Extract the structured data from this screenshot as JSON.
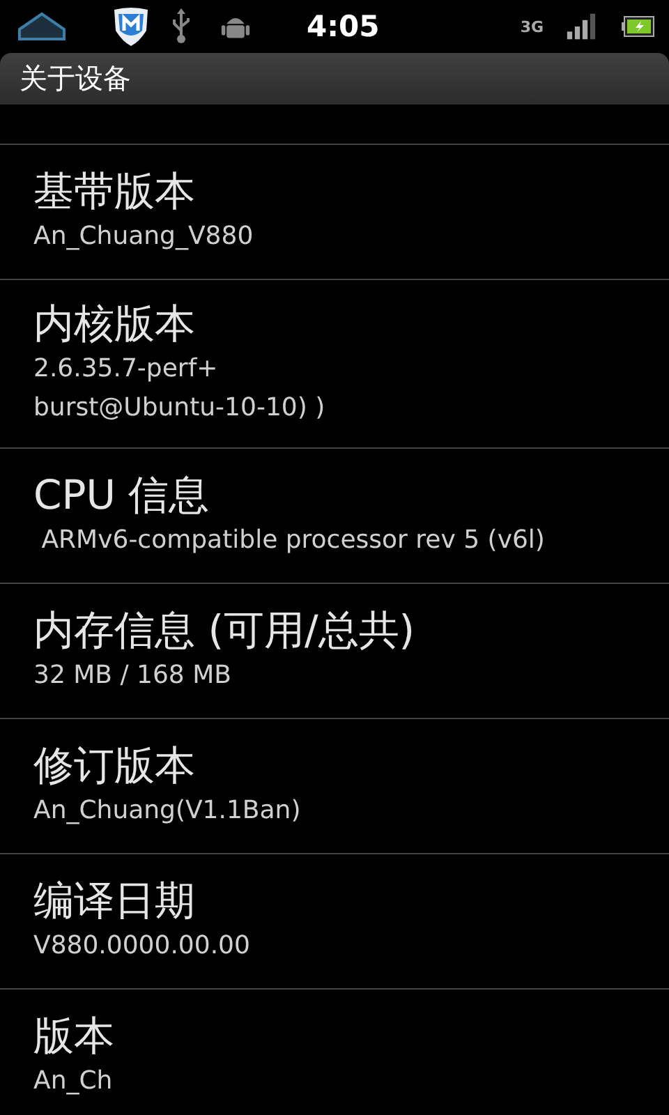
{
  "status_bar": {
    "time": "4:05",
    "network": "3G"
  },
  "title_bar": {
    "title": "关于设备"
  },
  "items": [
    {
      "title": "基带版本",
      "value": "An_Chuang_V880"
    },
    {
      "title": "内核版本",
      "value": "2.6.35.7-perf+\nburst@Ubuntu-10-10) )"
    },
    {
      "title": "CPU 信息",
      "value": " ARMv6-compatible processor rev 5 (v6l)"
    },
    {
      "title": "内存信息 (可用/总共)",
      "value": "32 MB / 168 MB"
    },
    {
      "title": "修订版本",
      "value": "An_Chuang(V1.1Ban)"
    },
    {
      "title": "编译日期",
      "value": "V880.0000.00.00"
    },
    {
      "title": "版本",
      "value": "An_Ch"
    }
  ]
}
